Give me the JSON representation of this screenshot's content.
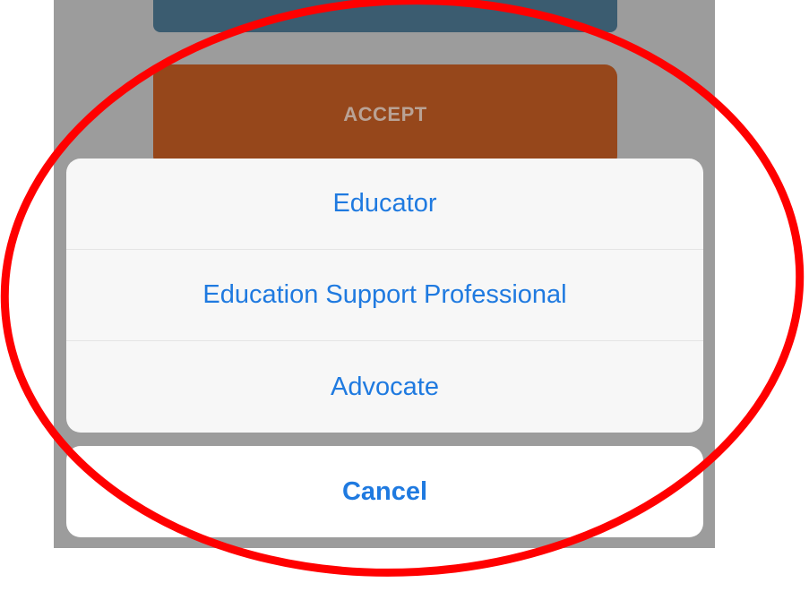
{
  "background_button": {
    "accept_label": "ACCEPT"
  },
  "action_sheet": {
    "options": [
      {
        "label": "Educator"
      },
      {
        "label": "Education Support Professional"
      },
      {
        "label": "Advocate"
      }
    ],
    "cancel_label": "Cancel"
  },
  "colors": {
    "dim_overlay": "#9c9c9c",
    "top_button": "#3b5c70",
    "accept_button": "#96471b",
    "action_text": "#1f7ae0",
    "annotation": "#ff0000"
  }
}
